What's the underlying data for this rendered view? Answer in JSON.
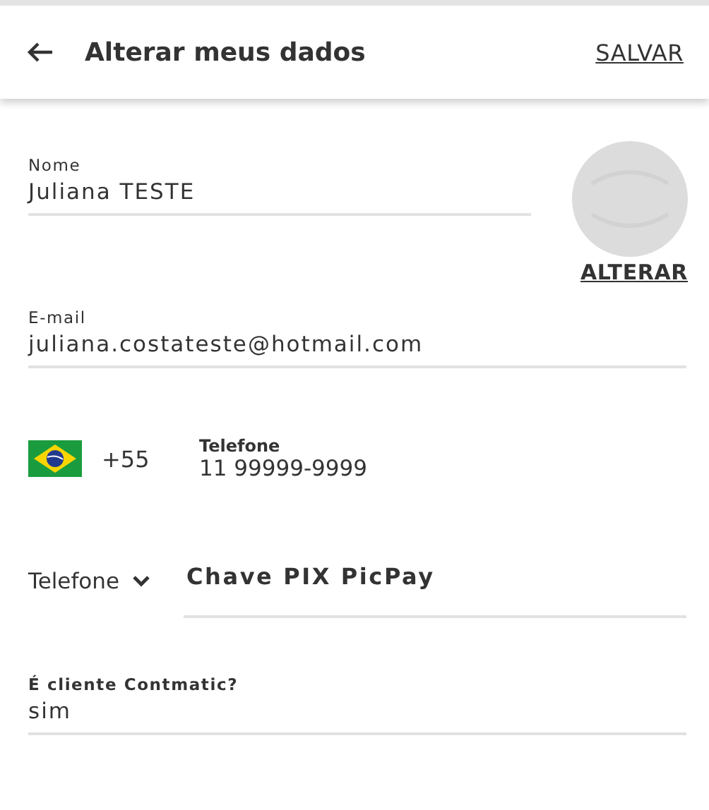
{
  "header": {
    "title": "Alterar meus dados",
    "action": "SALVAR"
  },
  "name_field": {
    "label": "Nome",
    "value": "Juliana TESTE"
  },
  "avatar": {
    "action": "ALTERAR"
  },
  "email_field": {
    "label": "E-mail",
    "value": "juliana.costateste@hotmail.com"
  },
  "phone": {
    "country_code": "+55",
    "label": "Telefone",
    "value": "11 99999-9999"
  },
  "pix": {
    "type": "Telefone",
    "value": "Chave PIX PicPay"
  },
  "client_field": {
    "label": "É cliente Contmatic?",
    "value": "sim"
  }
}
